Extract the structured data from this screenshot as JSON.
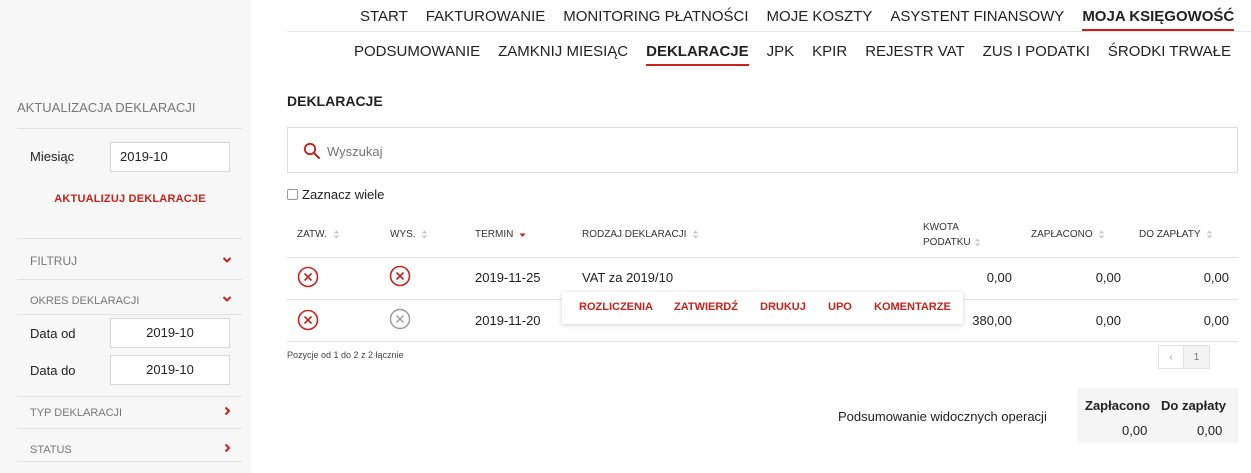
{
  "sidebar": {
    "update_title": "AKTUALIZACJA DEKLARACJI",
    "month_label": "Miesiąc",
    "month_value": "2019-10",
    "update_action": "AKTUALIZUJ DEKLARACJE",
    "filter_title": "FILTRUJ",
    "period_title": "OKRES DEKLARACJI",
    "date_from_label": "Data od",
    "date_from_value": "2019-10",
    "date_to_label": "Data do",
    "date_to_value": "2019-10",
    "type_title": "TYP DEKLARACJI",
    "status_title": "STATUS"
  },
  "main_nav": [
    {
      "label": "START"
    },
    {
      "label": "FAKTUROWANIE"
    },
    {
      "label": "MONITORING PŁATNOŚCI"
    },
    {
      "label": "MOJE KOSZTY"
    },
    {
      "label": "ASYSTENT FINANSOWY"
    },
    {
      "label": "MOJA KSIĘGOWOŚĆ"
    }
  ],
  "sub_nav": [
    {
      "label": "PODSUMOWANIE"
    },
    {
      "label": "ZAMKNIJ MIESIĄC"
    },
    {
      "label": "DEKLARACJE"
    },
    {
      "label": "JPK"
    },
    {
      "label": "KPIR"
    },
    {
      "label": "REJESTR VAT"
    },
    {
      "label": "ZUS I PODATKI"
    },
    {
      "label": "ŚRODKI TRWAŁE"
    }
  ],
  "page_title": "DEKLARACJE",
  "search": {
    "placeholder": "Wyszukaj"
  },
  "select_many": "Zaznacz wiele",
  "table": {
    "headers": {
      "approved": "ZATW.",
      "sent": "WYS.",
      "deadline": "TERMIN",
      "type": "RODZAJ DEKLARACJI",
      "tax_amount_1": "KWOTA",
      "tax_amount_2": "PODATKU",
      "paid": "ZAPŁACONO",
      "to_pay": "DO ZAPŁATY"
    },
    "rows": [
      {
        "deadline": "2019-11-25",
        "type": "VAT za 2019/10",
        "tax_amount": "0,00",
        "paid": "0,00",
        "to_pay": "0,00"
      },
      {
        "deadline": "2019-11-20",
        "type": "",
        "tax_amount": "380,00",
        "paid": "0,00",
        "to_pay": "0,00"
      }
    ]
  },
  "context_menu": {
    "settlements": "ROZLICZENIA",
    "approve": "ZATWIERDŹ",
    "print": "DRUKUJ",
    "upo": "UPO",
    "comments": "KOMENTARZE"
  },
  "pagination": {
    "info": "Pozycje od 1 do 2 z 2 łącznie",
    "prev": "‹",
    "page": "1"
  },
  "summary": {
    "label": "Podsumowanie widocznych operacji",
    "paid_header": "Zapłacono",
    "to_pay_header": "Do zapłaty",
    "paid_value": "0,00",
    "to_pay_value": "0,00"
  },
  "colors": {
    "accent": "#c8221c",
    "inactive_icon": "#999999"
  }
}
